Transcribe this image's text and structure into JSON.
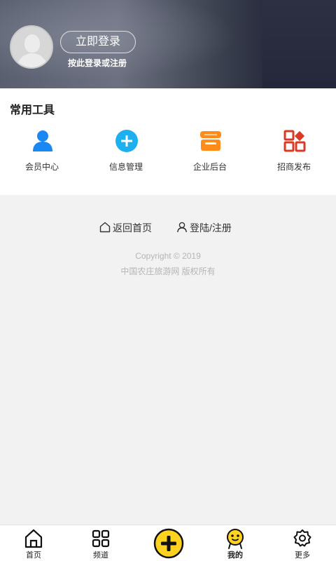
{
  "header": {
    "login_button": "立即登录",
    "login_hint": "按此登录或注册"
  },
  "tools": {
    "title": "常用工具",
    "items": [
      {
        "label": "会员中心",
        "icon": "member-icon",
        "color": "#1a88f2"
      },
      {
        "label": "信息管理",
        "icon": "plus-circle-icon",
        "color": "#1cb0f0"
      },
      {
        "label": "企业后台",
        "icon": "store-icon",
        "color": "#ff8c1a"
      },
      {
        "label": "招商发布",
        "icon": "apps-icon",
        "color": "#d93a26"
      }
    ]
  },
  "footer": {
    "home_link": "返回首页",
    "login_link": "登陆/注册",
    "copyright": "Copyright © 2019",
    "rights": "中国农庄旅游网 版权所有"
  },
  "bottom_nav": {
    "items": [
      {
        "label": "首页",
        "icon": "home-icon"
      },
      {
        "label": "频道",
        "icon": "grid-icon"
      },
      {
        "label": "",
        "icon": "add-icon",
        "color": "#ffd21f"
      },
      {
        "label": "我的",
        "icon": "smiley-icon",
        "color": "#ffd21f"
      },
      {
        "label": "更多",
        "icon": "gear-icon"
      }
    ]
  }
}
